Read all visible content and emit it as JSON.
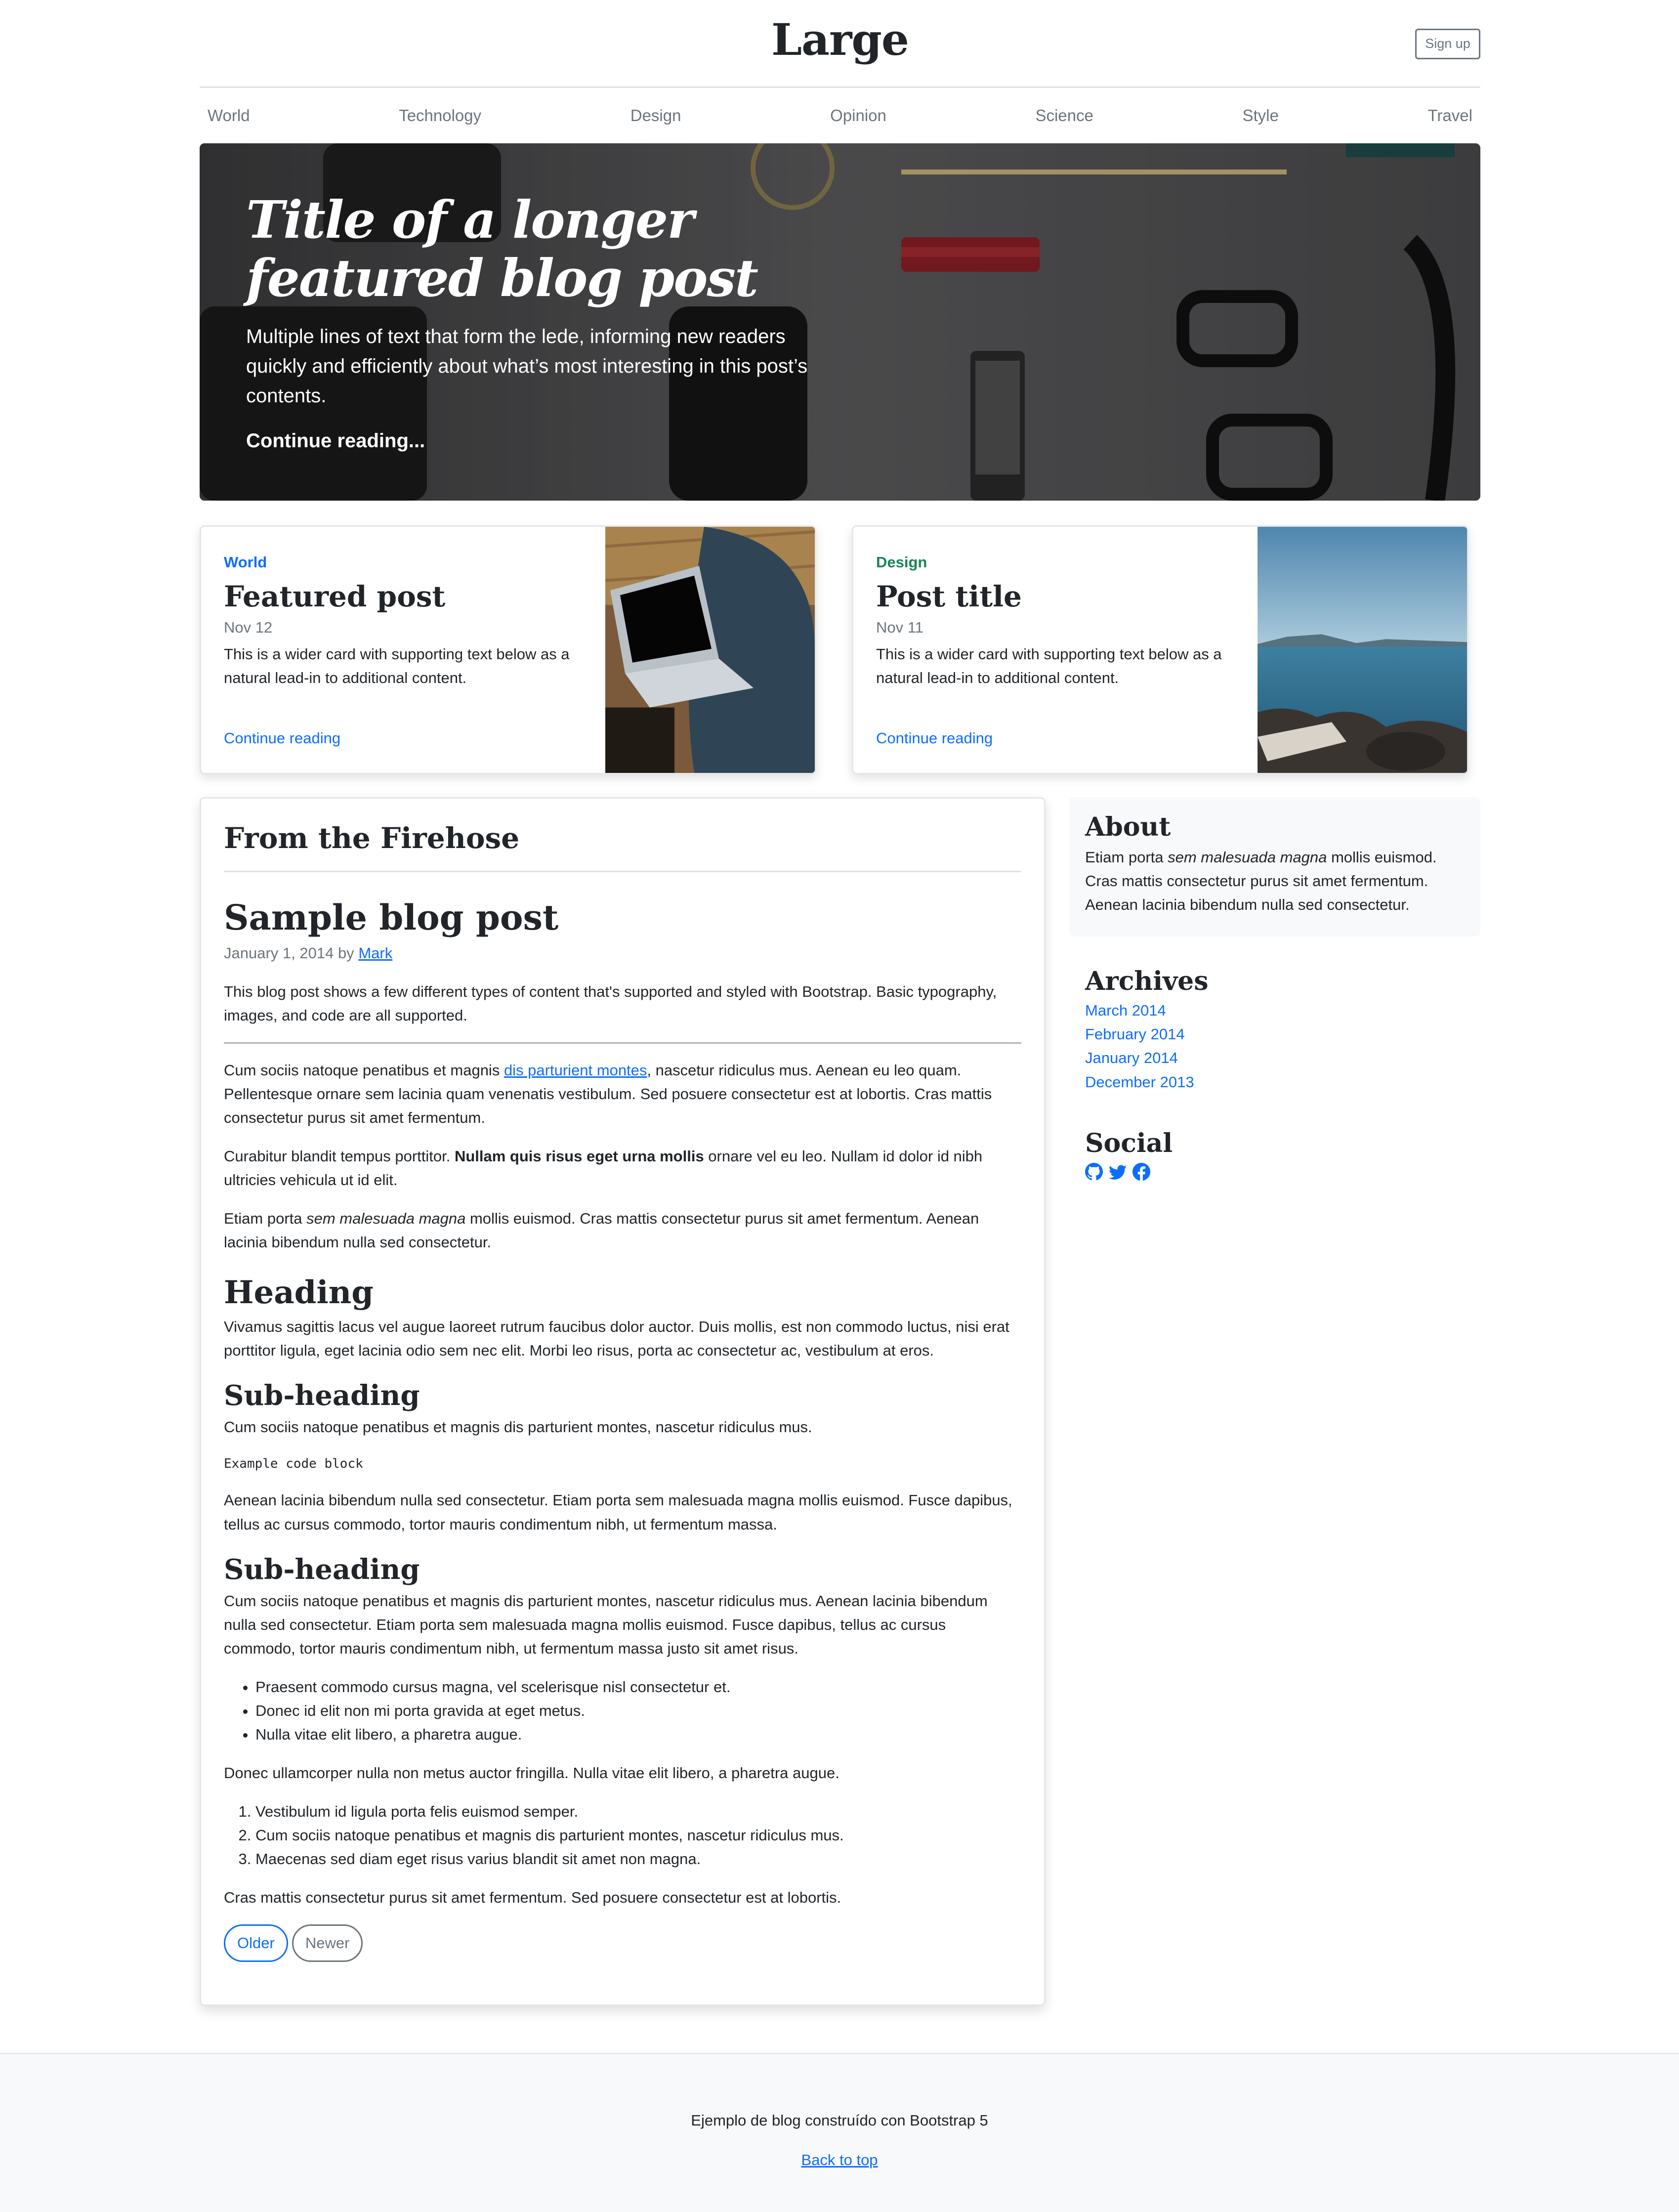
{
  "header": {
    "brand": "Large",
    "signup_label": "Sign up"
  },
  "nav": [
    "World",
    "Technology",
    "Design",
    "Opinion",
    "Science",
    "Style",
    "Travel"
  ],
  "hero": {
    "title": "Title of a longer featured blog post",
    "lede": "Multiple lines of text that form the lede, informing new readers quickly and efficiently about what’s most interesting in this post’s contents.",
    "link": "Continue reading..."
  },
  "cards": [
    {
      "category": "World",
      "category_color": "#0d6efd",
      "title": "Featured post",
      "date": "Nov 12",
      "text": "This is a wider card with supporting text below as a natural lead-in to additional content.",
      "link": "Continue reading"
    },
    {
      "category": "Design",
      "category_color": "#198754",
      "title": "Post title",
      "date": "Nov 11",
      "text": "This is a wider card with supporting text below as a natural lead-in to additional content.",
      "link": "Continue reading"
    }
  ],
  "main": {
    "section_title": "From the Firehose",
    "post_title": "Sample blog post",
    "post_date": "January 1, 2014 by",
    "post_author": "Mark",
    "intro": "This blog post shows a few different types of content that's supported and styled with Bootstrap. Basic typography, images, and code are all supported.",
    "p1_a": "Cum sociis natoque penatibus et magnis ",
    "p1_link": "dis parturient montes",
    "p1_b": ", nascetur ridiculus mus. Aenean eu leo quam. Pellentesque ornare sem lacinia quam venenatis vestibulum. Sed posuere consectetur est at lobortis. Cras mattis consectetur purus sit amet fermentum.",
    "p2_a": "Curabitur blandit tempus porttitor. ",
    "p2_bold": "Nullam quis risus eget urna mollis",
    "p2_b": " ornare vel eu leo. Nullam id dolor id nibh ultricies vehicula ut id elit.",
    "p3_a": "Etiam porta ",
    "p3_em": "sem malesuada magna",
    "p3_b": " mollis euismod. Cras mattis consectetur purus sit amet fermentum. Aenean lacinia bibendum nulla sed consectetur.",
    "heading": "Heading",
    "heading_p": "Vivamus sagittis lacus vel augue laoreet rutrum faucibus dolor auctor. Duis mollis, est non commodo luctus, nisi erat porttitor ligula, eget lacinia odio sem nec elit. Morbi leo risus, porta ac consectetur ac, vestibulum at eros.",
    "subheading_1": "Sub-heading",
    "subheading_1_p": "Cum sociis natoque penatibus et magnis dis parturient montes, nascetur ridiculus mus.",
    "code": "Example code block",
    "after_code_p": "Aenean lacinia bibendum nulla sed consectetur. Etiam porta sem malesuada magna mollis euismod. Fusce dapibus, tellus ac cursus commodo, tortor mauris condimentum nibh, ut fermentum massa.",
    "subheading_2": "Sub-heading",
    "subheading_2_p": "Cum sociis natoque penatibus et magnis dis parturient montes, nascetur ridiculus mus. Aenean lacinia bibendum nulla sed consectetur. Etiam porta sem malesuada magna mollis euismod. Fusce dapibus, tellus ac cursus commodo, tortor mauris condimentum nibh, ut fermentum massa justo sit amet risus.",
    "ul": [
      "Praesent commodo cursus magna, vel scelerisque nisl consectetur et.",
      "Donec id elit non mi porta gravida at eget metus.",
      "Nulla vitae elit libero, a pharetra augue."
    ],
    "mid_p": "Donec ullamcorper nulla non metus auctor fringilla. Nulla vitae elit libero, a pharetra augue.",
    "ol": [
      "Vestibulum id ligula porta felis euismod semper.",
      "Cum sociis natoque penatibus et magnis dis parturient montes, nascetur ridiculus mus.",
      "Maecenas sed diam eget risus varius blandit sit amet non magna."
    ],
    "final_p": "Cras mattis consectetur purus sit amet fermentum. Sed posuere consectetur est at lobortis.",
    "pager_older": "Older",
    "pager_newer": "Newer"
  },
  "sidebar": {
    "about_title": "About",
    "about_a": "Etiam porta ",
    "about_em": "sem malesuada magna",
    "about_b": " mollis euismod. Cras mattis consectetur purus sit amet fermentum. Aenean lacinia bibendum nulla sed consectetur.",
    "archives_title": "Archives",
    "archives": [
      "March 2014",
      "February 2014",
      "January 2014",
      "December 2013"
    ],
    "social_title": "Social",
    "social_icons": [
      "github-icon",
      "twitter-icon",
      "facebook-icon"
    ]
  },
  "footer": {
    "text": "Ejemplo de blog construído con Bootstrap 5",
    "back_to_top": "Back to top"
  },
  "colors": {
    "accent": "#0d6efd",
    "muted": "#6c757d",
    "design_green": "#198754",
    "light_bg": "#f8f9fa"
  }
}
